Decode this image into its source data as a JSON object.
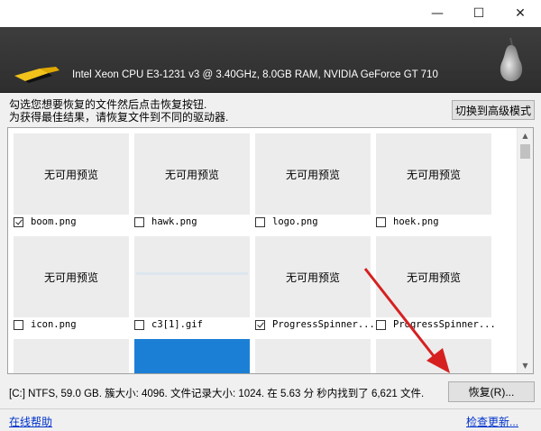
{
  "window": {
    "controls": {
      "minimize": "—",
      "maximize": "☐",
      "close": "✕"
    }
  },
  "header": {
    "system_info": "Intel Xeon CPU E3-1231 v3 @ 3.40GHz, 8.0GB RAM, NVIDIA GeForce GT 710",
    "logo_icon": "broom-icon",
    "brand_icon": "pear-icon"
  },
  "instructions": {
    "line1": "勾选您想要恢复的文件然后点击恢复按钮.",
    "line2": "为获得最佳结果，请恢复文件到不同的驱动器."
  },
  "advanced_button": "切换到高级模式",
  "files": [
    {
      "name": "boom.png",
      "checked": true,
      "preview": "无可用预览"
    },
    {
      "name": "hawk.png",
      "checked": false,
      "preview": "无可用预览"
    },
    {
      "name": "logo.png",
      "checked": false,
      "preview": "无可用预览"
    },
    {
      "name": "hoek.png",
      "checked": false,
      "preview": "无可用预览"
    },
    {
      "name": "icon.png",
      "checked": false,
      "preview": "无可用预览"
    },
    {
      "name": "c3[1].gif",
      "checked": false,
      "preview": ""
    },
    {
      "name": "ProgressSpinner...",
      "checked": true,
      "preview": "无可用预览"
    },
    {
      "name": "ProgressSpinner...",
      "checked": false,
      "preview": "无可用预览"
    }
  ],
  "status": "[C:] NTFS, 59.0 GB. 簇大小: 4096. 文件记录大小: 1024. 在 5.63 分 秒内找到了 6,621 文件.",
  "recover_button": "恢复(R)...",
  "footer": {
    "help_link": "在线帮助",
    "update_link": "检查更新..."
  },
  "colors": {
    "header_bg": "#353535",
    "link": "#0033cc",
    "arrow": "#d62020",
    "preview_blue": "#1c7fd6"
  }
}
